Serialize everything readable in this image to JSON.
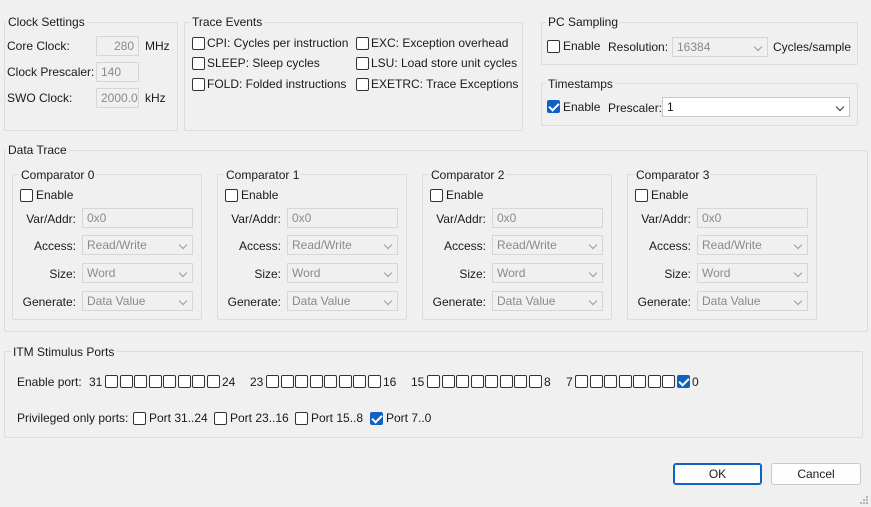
{
  "clock": {
    "title": "Clock Settings",
    "core_label": "Core Clock:",
    "core_value": "280",
    "core_unit": "MHz",
    "prescaler_label": "Clock Prescaler:",
    "prescaler_value": "140",
    "swo_label": "SWO Clock:",
    "swo_value": "2000.0",
    "swo_unit": "kHz"
  },
  "trace": {
    "title": "Trace Events",
    "items": [
      {
        "label": "CPI: Cycles per instruction",
        "checked": false
      },
      {
        "label": "SLEEP: Sleep cycles",
        "checked": false
      },
      {
        "label": "FOLD: Folded instructions",
        "checked": false
      },
      {
        "label": "EXC: Exception overhead",
        "checked": false
      },
      {
        "label": "LSU: Load store unit cycles",
        "checked": false
      },
      {
        "label": "EXETRC: Trace Exceptions",
        "checked": false
      }
    ]
  },
  "pc": {
    "title": "PC Sampling",
    "enable_label": "Enable",
    "enabled": false,
    "resolution_label": "Resolution:",
    "resolution_value": "16384",
    "unit": "Cycles/sample"
  },
  "ts": {
    "title": "Timestamps",
    "enable_label": "Enable",
    "enabled": true,
    "prescaler_label": "Prescaler:",
    "prescaler_value": "1"
  },
  "datatrace": {
    "title": "Data Trace",
    "enable_label": "Enable",
    "var_label": "Var/Addr:",
    "access_label": "Access:",
    "size_label": "Size:",
    "generate_label": "Generate:",
    "comparators": [
      {
        "title": "Comparator 0",
        "var": "0x0",
        "access": "Read/Write",
        "size": "Word",
        "generate": "Data Value"
      },
      {
        "title": "Comparator 1",
        "var": "0x0",
        "access": "Read/Write",
        "size": "Word",
        "generate": "Data Value"
      },
      {
        "title": "Comparator 2",
        "var": "0x0",
        "access": "Read/Write",
        "size": "Word",
        "generate": "Data Value"
      },
      {
        "title": "Comparator 3",
        "var": "0x0",
        "access": "Read/Write",
        "size": "Word",
        "generate": "Data Value"
      }
    ]
  },
  "itm": {
    "title": "ITM Stimulus Ports",
    "enable_label": "Enable port:",
    "groups": [
      {
        "hi": "31",
        "lo": "24",
        "checked": [
          false,
          false,
          false,
          false,
          false,
          false,
          false,
          false
        ]
      },
      {
        "hi": "23",
        "lo": "16",
        "checked": [
          false,
          false,
          false,
          false,
          false,
          false,
          false,
          false
        ]
      },
      {
        "hi": "15",
        "lo": "8",
        "checked": [
          false,
          false,
          false,
          false,
          false,
          false,
          false,
          false
        ]
      },
      {
        "hi": "7",
        "lo": "0",
        "checked": [
          false,
          false,
          false,
          false,
          false,
          false,
          false,
          true
        ]
      }
    ],
    "priv_label": "Privileged only ports:",
    "priv": [
      {
        "label": "Port 31..24",
        "checked": false
      },
      {
        "label": "Port 23..16",
        "checked": false
      },
      {
        "label": "Port 15..8",
        "checked": false
      },
      {
        "label": "Port 7..0",
        "checked": true
      }
    ]
  },
  "buttons": {
    "ok": "OK",
    "cancel": "Cancel"
  }
}
